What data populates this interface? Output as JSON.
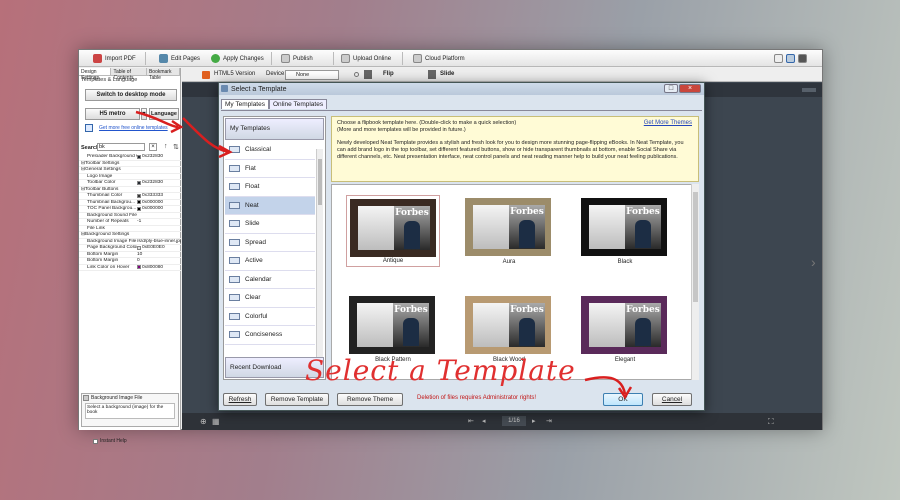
{
  "toolbar": {
    "items": [
      {
        "label": "Import PDF",
        "color": "#c44"
      },
      {
        "label": "Edit Pages",
        "color": "#58a"
      },
      {
        "label": "Apply Changes",
        "color": "#4a4"
      },
      {
        "label": "Publish",
        "color": "#4888c8"
      },
      {
        "label": "Upload Online",
        "color": "#4888c8"
      },
      {
        "label": "Cloud Platform",
        "color": "#4888c8"
      }
    ]
  },
  "left_panel": {
    "tabs": [
      "Design Settings",
      "Table of Contents",
      "Bookmark Table"
    ],
    "section": "Templates & Language",
    "switch_button": "Switch to desktop mode",
    "template_button": "H5 metro",
    "language_button": "Language",
    "more_link": "Get more free online templates",
    "search_label": "Search:",
    "search_value": "bk",
    "properties": [
      {
        "k": "Preloader Background C...",
        "v": "0x232830",
        "c": "#232830"
      },
      {
        "k": "⊟Toolbar Settings",
        "v": ""
      },
      {
        "k": "⊟General Settings",
        "v": ""
      },
      {
        "k": "Logo Image",
        "v": ""
      },
      {
        "k": "Toolbar Color",
        "v": "0x232830",
        "c": "#232830"
      },
      {
        "k": "⊟Toolbar Buttons",
        "v": ""
      },
      {
        "k": "Thumbnail Color",
        "v": "0x333333",
        "c": "#333333"
      },
      {
        "k": "Thumbnail Backgrou...",
        "v": "0x000000",
        "c": "#000000"
      },
      {
        "k": "TOC Panel Backgrou...",
        "v": "0x000000",
        "c": "#000000"
      },
      {
        "k": "Background Sound File",
        "v": ""
      },
      {
        "k": "Number of Repeats",
        "v": "-1"
      },
      {
        "k": "File Link",
        "v": ""
      },
      {
        "k": "⊟Background Settings",
        "v": ""
      },
      {
        "k": "Background Image File",
        "v": "/s/d/ply-blue-inner.jpg"
      },
      {
        "k": "Page Background Color",
        "v": "0xE0E0E0",
        "c": "#e0e0e0"
      },
      {
        "k": "Bottom Margin",
        "v": "10"
      },
      {
        "k": "Bottom Margin",
        "v": "0"
      },
      {
        "k": "Link Color on Hover",
        "v": "0x800080",
        "c": "#800080"
      }
    ],
    "help_title": "Background Image File",
    "help_text": "Select a background (image) for the book",
    "instant_help": "Instant Help"
  },
  "main": {
    "version": "HTML5 Version",
    "device_label": "Device:",
    "device_value": "None",
    "flip": "Flip",
    "slide": "Slide",
    "page_counter": "1/16"
  },
  "dialog": {
    "title": "Select a Template",
    "tabs": [
      "My Templates",
      "Online Templates"
    ],
    "group_top": "My Templates",
    "templates": [
      "Classical",
      "Flat",
      "Float",
      "Neat",
      "Slide",
      "Spread",
      "Active",
      "Calendar",
      "Clear",
      "Colorful",
      "Conciseness"
    ],
    "selected_template": "Neat",
    "group_bottom": "Recent Download",
    "info_line1": "Choose a flipbook template here. (Double-click to make a quick selection)",
    "info_line2": "(More and more templates will be provided in future.)",
    "get_more": "Get More Themes",
    "info_para": "Newly developed Neat Template provides a stylish and fresh look for you to design more stunning page-flipping eBooks. In Neat Template, you can add brand logo in the top toolbar, set different featured buttons, show or hide transparent thumbnails at bottom, enable Social Share via different channels, etc. Neat presentation interface, neat control panels and neat reading manner help to build your neat feeling publications.",
    "themes": [
      {
        "name": "Antique",
        "bg": "#3a2a22"
      },
      {
        "name": "Aura",
        "bg": "#9c8c6a"
      },
      {
        "name": "Black",
        "bg": "#111111"
      },
      {
        "name": "Black Pattern",
        "bg": "#222222"
      },
      {
        "name": "Black Wood",
        "bg": "#b89a72"
      },
      {
        "name": "Elegant",
        "bg": "#5a2a5a"
      }
    ],
    "magazine_title": "Forbes",
    "buttons": {
      "refresh": "Refresh",
      "remove_template": "Remove Template",
      "remove_theme": "Remove Theme",
      "ok": "OK",
      "cancel": "Cancel"
    },
    "warning": "Deletion of files requires Administrator rights!"
  },
  "annotation": "Select a Template"
}
